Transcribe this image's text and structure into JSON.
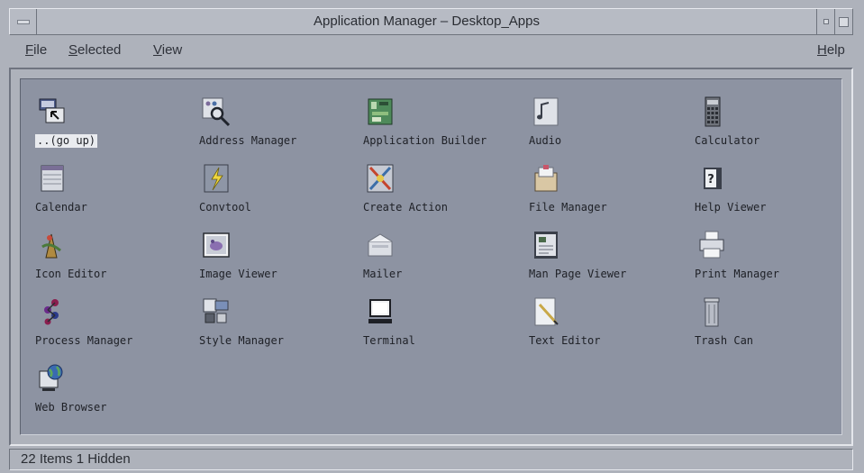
{
  "window": {
    "title": "Application Manager – Desktop_Apps"
  },
  "menubar": {
    "file": {
      "mnemonic": "F",
      "rest": "ile"
    },
    "selected": {
      "mnemonic": "S",
      "rest": "elected"
    },
    "view": {
      "mnemonic": "V",
      "rest": "iew"
    },
    "help": {
      "mnemonic": "H",
      "rest": "elp"
    }
  },
  "apps": [
    {
      "label": "..(go up)",
      "icon": "go-up-icon",
      "selected": true
    },
    {
      "label": "Address Manager",
      "icon": "address-manager-icon"
    },
    {
      "label": "Application Builder",
      "icon": "application-builder-icon"
    },
    {
      "label": "Audio",
      "icon": "audio-icon"
    },
    {
      "label": "Calculator",
      "icon": "calculator-icon"
    },
    {
      "label": "Calendar",
      "icon": "calendar-icon"
    },
    {
      "label": "Convtool",
      "icon": "convtool-icon"
    },
    {
      "label": "Create Action",
      "icon": "create-action-icon"
    },
    {
      "label": "File Manager",
      "icon": "file-manager-icon"
    },
    {
      "label": "Help Viewer",
      "icon": "help-viewer-icon"
    },
    {
      "label": "Icon Editor",
      "icon": "icon-editor-icon"
    },
    {
      "label": "Image Viewer",
      "icon": "image-viewer-icon"
    },
    {
      "label": "Mailer",
      "icon": "mailer-icon"
    },
    {
      "label": "Man Page Viewer",
      "icon": "man-page-viewer-icon"
    },
    {
      "label": "Print Manager",
      "icon": "print-manager-icon"
    },
    {
      "label": "Process Manager",
      "icon": "process-manager-icon"
    },
    {
      "label": "Style Manager",
      "icon": "style-manager-icon"
    },
    {
      "label": "Terminal",
      "icon": "terminal-icon"
    },
    {
      "label": "Text Editor",
      "icon": "text-editor-icon"
    },
    {
      "label": "Trash Can",
      "icon": "trash-can-icon"
    },
    {
      "label": "Web Browser",
      "icon": "web-browser-icon"
    }
  ],
  "status": {
    "text": "22 Items 1 Hidden"
  }
}
